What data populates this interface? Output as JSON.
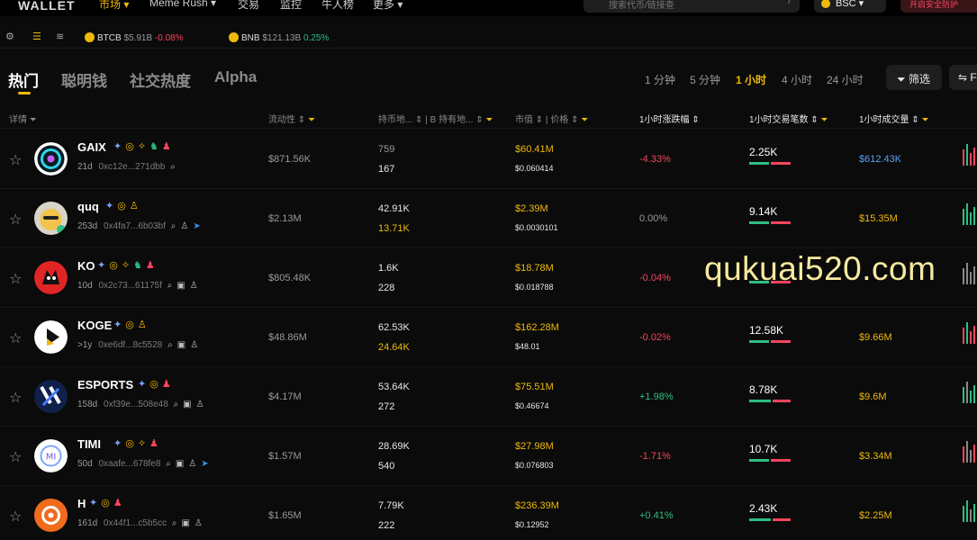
{
  "nav": {
    "logo": "WALLET",
    "items": [
      "市场 ▾",
      "Meme Rush ▾",
      "交易",
      "监控",
      "牛人榜",
      "更多 ▾"
    ],
    "search_placeholder": "搜索代币/链接查",
    "search_kbd": "/",
    "chain": "BSC ▾",
    "secure": "开启安全防护"
  },
  "ticker": [
    {
      "name": "BTCB",
      "value": "$5.91B",
      "change": "-0.08%",
      "dir": "neg"
    },
    {
      "name": "BNB",
      "value": "$121.13B",
      "change": "0.25%",
      "dir": "pos"
    }
  ],
  "tabs": [
    "热门",
    "聪明钱",
    "社交热度",
    "Alpha"
  ],
  "timeframes": [
    "1 分钟",
    "5 分钟",
    "1 小时",
    "4 小时",
    "24 小时"
  ],
  "filter_label": "筛选",
  "more_label": "F",
  "headers": {
    "details": "详情",
    "liquidity": "流动性",
    "holders": "持币地...",
    "b_holders": "B 持有地...",
    "mcap": "市值",
    "price": "价格",
    "change": "1小时涨跌幅",
    "txs": "1小时交易笔数",
    "volume": "1小时成交量"
  },
  "rows": [
    {
      "symbol": "GAIX",
      "tags": [
        "✦",
        "◎",
        "✧",
        "♞",
        "♟"
      ],
      "age": "21d",
      "addr": "0xc12e...271dbb",
      "actions": [
        "⌕"
      ],
      "liquidity": "$871.56K",
      "holders": "759",
      "b_holders": "167",
      "holders_dim": true,
      "b_gold": false,
      "mcap": "$60.41M",
      "price": "$0.060414",
      "change": "-4.33%",
      "dir": "neg",
      "txs": "2.25K",
      "buy": 0.5,
      "volume": "$612.43K",
      "vol_blue": true
    },
    {
      "symbol": "quq",
      "tags": [
        "✦",
        "◎",
        "♙"
      ],
      "age": "253d",
      "addr": "0x4fa7...6b03bf",
      "actions": [
        "⌕",
        "♙",
        "➤"
      ],
      "liquidity": "$2.13M",
      "holders": "42.91K",
      "b_holders": "13.71K",
      "holders_dim": false,
      "b_gold": true,
      "mcap": "$2.39M",
      "price": "$0.0030101",
      "change": "0.00%",
      "dir": "zero",
      "txs": "9.14K",
      "buy": 0.5,
      "volume": "$15.35M",
      "vol_blue": false
    },
    {
      "symbol": "KO",
      "tags": [
        "✦",
        "◎",
        "✧",
        "♞",
        "♟"
      ],
      "age": "10d",
      "addr": "0x2c73...61175f",
      "actions": [
        "⌕",
        "▣",
        "♙"
      ],
      "liquidity": "$805.48K",
      "holders": "1.6K",
      "b_holders": "228",
      "holders_dim": false,
      "b_gold": false,
      "mcap": "$18.78M",
      "price": "$0.018788",
      "change": "-0.04%",
      "dir": "neg",
      "txs": "",
      "buy": 0.5,
      "volume": "",
      "vol_blue": false
    },
    {
      "symbol": "KOGE",
      "tags": [
        "✦",
        "◎",
        "♙"
      ],
      "age": ">1y",
      "addr": "0xe6df...8c5528",
      "actions": [
        "⌕",
        "▣",
        "♙"
      ],
      "liquidity": "$48.86M",
      "holders": "62.53K",
      "b_holders": "24.64K",
      "holders_dim": false,
      "b_gold": true,
      "mcap": "$162.28M",
      "price": "$48.01",
      "change": "-0.02%",
      "dir": "neg",
      "txs": "12.58K",
      "buy": 0.5,
      "volume": "$9.66M",
      "vol_blue": false
    },
    {
      "symbol": "ESPORTS",
      "tags": [
        "✦",
        "◎",
        "♟"
      ],
      "age": "158d",
      "addr": "0xf39e...508e48",
      "actions": [
        "⌕",
        "▣",
        "♙"
      ],
      "liquidity": "$4.17M",
      "holders": "53.64K",
      "b_holders": "272",
      "holders_dim": false,
      "b_gold": false,
      "mcap": "$75.51M",
      "price": "$0.46674",
      "change": "+1.98%",
      "dir": "pos",
      "txs": "8.78K",
      "buy": 0.55,
      "volume": "$9.6M",
      "vol_blue": false
    },
    {
      "symbol": "TIMI",
      "tags": [
        "✦",
        "◎",
        "✧",
        "♟"
      ],
      "age": "50d",
      "addr": "0xaafe...678fe8",
      "actions": [
        "⌕",
        "▣",
        "♙",
        "➤"
      ],
      "liquidity": "$1.57M",
      "holders": "28.69K",
      "b_holders": "540",
      "holders_dim": false,
      "b_gold": false,
      "mcap": "$27.98M",
      "price": "$0.076803",
      "change": "-1.71%",
      "dir": "neg",
      "txs": "10.7K",
      "buy": 0.5,
      "volume": "$3.34M",
      "vol_blue": false
    },
    {
      "symbol": "H",
      "tags": [
        "✦",
        "◎",
        "♟"
      ],
      "age": "161d",
      "addr": "0x44f1...c5b5cc",
      "actions": [
        "⌕",
        "▣",
        "♙"
      ],
      "liquidity": "$1.65M",
      "holders": "7.79K",
      "b_holders": "222",
      "holders_dim": false,
      "b_gold": false,
      "mcap": "$236.39M",
      "price": "$0.12952",
      "change": "+0.41%",
      "dir": "pos",
      "txs": "2.43K",
      "buy": 0.55,
      "volume": "$2.25M",
      "vol_blue": false
    }
  ],
  "watermark": "qukuai520.com"
}
